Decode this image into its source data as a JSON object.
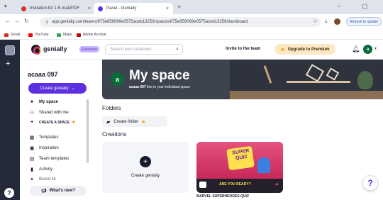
{
  "browser": {
    "tabs": [
      {
        "label": "Invitation für 1 E-mail/PDF",
        "favicon_color": "#d93025"
      },
      {
        "label": "Panel - Genially",
        "favicon_color": "#5c2fe0"
      }
    ],
    "url": "app.genially.com/teams/675e859069e0575aceb13253/spaces/675e859069e0575aceb13256/dashboard",
    "update_label": "Refresh to update",
    "bookmarks": [
      {
        "label": "Gmail",
        "icon": "gmail-icon",
        "color": "#d93025"
      },
      {
        "label": "YouTube",
        "icon": "youtube-icon",
        "color": "#ff0000"
      },
      {
        "label": "Maps",
        "icon": "maps-icon",
        "color": "#34a853"
      },
      {
        "label": "Adobe Acrobat",
        "icon": "acrobat-icon",
        "color": "#b30b00"
      }
    ]
  },
  "header": {
    "brand": "genially",
    "brand_badge": "Education",
    "search_placeholder": "Search your creations",
    "invite_label": "Invite to the team",
    "upgrade_label": "Upgrade to Premium",
    "avatar_initial": "a"
  },
  "sidebar": {
    "username": "acaaa 097",
    "create_button": "Create genially",
    "items": [
      {
        "label": "My space",
        "icon": "home-icon"
      },
      {
        "label": "Shared with me",
        "icon": "shared-icon"
      },
      {
        "label": "CREATE A SPACE",
        "icon": "plus-icon"
      },
      {
        "label": "Templates",
        "icon": "templates-icon"
      },
      {
        "label": "Inspiration",
        "icon": "inspiration-icon"
      },
      {
        "label": "Team templates",
        "icon": "team-templates-icon"
      },
      {
        "label": "Activity",
        "icon": "activity-icon"
      },
      {
        "label": "Brand kit",
        "icon": "brand-kit-icon"
      }
    ],
    "whats_new": "What's new?"
  },
  "main": {
    "avatar_initial": "a",
    "title": "My space",
    "subtitle_user": "acaaa 097",
    "subtitle_rest": " this is your individual space",
    "folders_heading": "Folders",
    "create_folder": "Create folder",
    "creations_heading": "Creations",
    "new_creation_label": "Create genially",
    "quiz_card": {
      "line1": "SUPER",
      "line2": "QUIZ",
      "ready_text": "ARE YOU READY?",
      "title": "MARVEL SUPERHEROES QUIZ"
    }
  },
  "colors": {
    "accent": "#5c2fe0",
    "rail": "#252a3a",
    "quiz_pink": "#dc3b6a"
  }
}
